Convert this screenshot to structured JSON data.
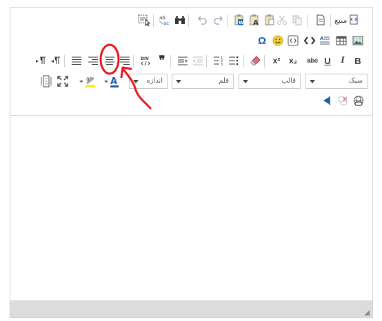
{
  "toolbar": {
    "source_label": "منبع",
    "styles_combo": "سبک",
    "format_combo": "قالب",
    "font_combo": "قلم",
    "size_combo": "اندازه",
    "bold_label": "B",
    "italic_label": "I",
    "underline_label": "U",
    "strike_label": "abc",
    "subscript_label": "x₂",
    "superscript_label": "x²",
    "blockquote_label": "❞",
    "omega_label": "Ω",
    "smiley_label": "🙂"
  },
  "colors": {
    "accent_blue": "#1b5ea8",
    "annotation_red": "#e3161b",
    "toolbar_bg": "#ffffff",
    "footer_bg": "#dcdcdc"
  }
}
